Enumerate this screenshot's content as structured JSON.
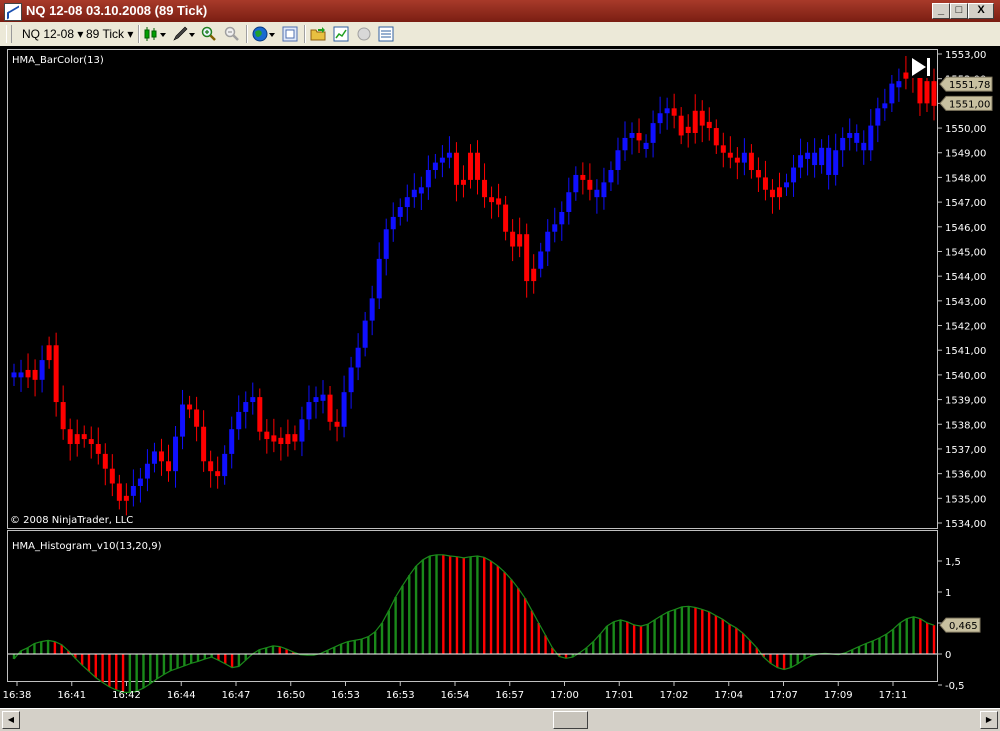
{
  "window": {
    "title": "NQ 12-08  03.10.2008 (89 Tick)",
    "minimize": "_",
    "maximize": "□",
    "close": "X"
  },
  "toolbar": {
    "instrument": "NQ 12-08",
    "interval": "89 Tick",
    "dropdown_glyph": "▾",
    "icons": [
      "candlestick-icon",
      "pencil-icon",
      "zoom-in-icon",
      "zoom-out-icon",
      "globe-icon",
      "data-box-icon",
      "folder-icon",
      "chart-properties-icon",
      "record-icon",
      "list-icon"
    ]
  },
  "price_panel": {
    "indicator_label": "HMA_BarColor(13)",
    "copyright": "© 2008 NinjaTrader, LLC",
    "y_ticks": [
      "1553,00",
      "1552,00",
      "1551,00",
      "1550,00",
      "1549,00",
      "1548,00",
      "1547,00",
      "1546,00",
      "1545,00",
      "1544,00",
      "1543,00",
      "1542,00",
      "1541,00",
      "1540,00",
      "1539,00",
      "1538,00",
      "1537,00",
      "1536,00",
      "1535,00",
      "1534,00"
    ],
    "y_tick_values": [
      1553,
      1552,
      1551,
      1550,
      1549,
      1548,
      1547,
      1546,
      1545,
      1544,
      1543,
      1542,
      1541,
      1540,
      1539,
      1538,
      1537,
      1536,
      1535,
      1534
    ],
    "price_tags": [
      {
        "text": "1551,78",
        "value": 1551.78
      },
      {
        "text": "1551,00",
        "value": 1551.0
      }
    ],
    "colors": {
      "up": "#1010ff",
      "down": "#ff0000",
      "background": "#000000"
    }
  },
  "histogram_panel": {
    "indicator_label": "HMA_Histogram_v10(13,20,9)",
    "y_ticks": [
      "1,5",
      "1",
      "0,5",
      "0",
      "-0,5"
    ],
    "y_tick_values": [
      1.5,
      1,
      0.5,
      0,
      -0.5
    ],
    "value_tag": {
      "text": "0,465",
      "value": 0.465
    },
    "colors": {
      "rising": "#1a8a1a",
      "falling": "#ff0000",
      "line": "#1a8a1a",
      "zero_line": "#ffffff"
    }
  },
  "x_axis": {
    "labels": [
      "16:38",
      "16:41",
      "16:42",
      "16:44",
      "16:47",
      "16:50",
      "16:53",
      "16:53",
      "16:54",
      "16:57",
      "17:00",
      "17:01",
      "17:02",
      "17:04",
      "17:07",
      "17:09",
      "17:11"
    ]
  },
  "chart_data": [
    {
      "type": "candlestick",
      "ylim": [
        1534,
        1553
      ],
      "close": [
        1540.1,
        1539.9,
        1540.2,
        1539.8,
        1540.6,
        1541.2,
        1538.9,
        1537.8,
        1537.2,
        1537.6,
        1537.4,
        1537.2,
        1536.8,
        1536.2,
        1535.6,
        1534.9,
        1535.1,
        1535.5,
        1535.8,
        1536.4,
        1536.9,
        1536.5,
        1536.1,
        1537.5,
        1538.8,
        1538.6,
        1537.9,
        1536.5,
        1536.1,
        1535.9,
        1536.8,
        1537.8,
        1538.5,
        1538.9,
        1539.1,
        1537.7,
        1537.4,
        1537.3,
        1537.2,
        1537.6,
        1537.3,
        1538.2,
        1538.9,
        1539.1,
        1539.2,
        1538.1,
        1537.9,
        1539.3,
        1540.3,
        1541.1,
        1542.2,
        1543.1,
        1544.7,
        1545.9,
        1546.4,
        1546.8,
        1547.2,
        1547.5,
        1547.6,
        1548.3,
        1548.6,
        1548.8,
        1549.0,
        1547.7,
        1547.9,
        1549.0,
        1547.9,
        1547.2,
        1547.0,
        1546.9,
        1545.8,
        1545.2,
        1545.7,
        1543.8,
        1544.3,
        1545.0,
        1545.8,
        1546.1,
        1546.6,
        1547.4,
        1548.1,
        1547.9,
        1547.5,
        1547.2,
        1547.8,
        1548.3,
        1549.1,
        1549.6,
        1549.8,
        1549.5,
        1549.4,
        1550.2,
        1550.6,
        1550.8,
        1550.5,
        1549.7,
        1549.8,
        1550.7,
        1550.1,
        1550.0,
        1549.3,
        1549.0,
        1548.8,
        1548.6,
        1549.0,
        1548.3,
        1548.0,
        1547.5,
        1547.2,
        1547.6,
        1547.8,
        1548.4,
        1548.9,
        1549.0,
        1548.5,
        1549.2,
        1548.1,
        1549.1,
        1549.6,
        1549.8,
        1549.4,
        1549.1,
        1550.1,
        1550.8,
        1551.0,
        1551.8,
        1551.9,
        1552.0,
        1552.1,
        1551.0,
        1551.9,
        1550.9
      ],
      "up_down": [
        1,
        1,
        0,
        0,
        1,
        0,
        0,
        0,
        0,
        0,
        0,
        0,
        0,
        0,
        0,
        0,
        0,
        1,
        1,
        1,
        1,
        0,
        0,
        1,
        1,
        0,
        0,
        0,
        0,
        0,
        1,
        1,
        1,
        1,
        1,
        0,
        0,
        0,
        0,
        0,
        0,
        1,
        1,
        1,
        1,
        0,
        0,
        1,
        1,
        1,
        1,
        1,
        1,
        1,
        1,
        1,
        1,
        1,
        1,
        1,
        1,
        1,
        1,
        0,
        0,
        0,
        0,
        0,
        0,
        0,
        0,
        0,
        0,
        0,
        0,
        1,
        1,
        1,
        1,
        1,
        1,
        0,
        0,
        1,
        1,
        1,
        1,
        1,
        1,
        0,
        1,
        1,
        1,
        1,
        0,
        0,
        0,
        0,
        0,
        0,
        0,
        0,
        0,
        0,
        1,
        0,
        0,
        0,
        0,
        0,
        1,
        1,
        1,
        1,
        1,
        1,
        1,
        1,
        1,
        1,
        1,
        1,
        1,
        1,
        1,
        1,
        1,
        0,
        0,
        0,
        0,
        0
      ]
    },
    {
      "type": "bar",
      "ylim": [
        -0.6,
        1.6
      ],
      "values": [
        -0.08,
        0.05,
        0.1,
        0.17,
        0.2,
        0.22,
        0.2,
        0.15,
        0.05,
        -0.07,
        -0.18,
        -0.28,
        -0.38,
        -0.46,
        -0.53,
        -0.58,
        -0.62,
        -0.62,
        -0.6,
        -0.55,
        -0.48,
        -0.4,
        -0.33,
        -0.27,
        -0.23,
        -0.19,
        -0.15,
        -0.12,
        -0.08,
        -0.05,
        -0.1,
        -0.16,
        -0.22,
        -0.2,
        -0.1,
        0.0,
        0.07,
        0.1,
        0.13,
        0.12,
        0.08,
        0.03,
        -0.01,
        -0.02,
        -0.02,
        0.01,
        0.06,
        0.11,
        0.16,
        0.2,
        0.22,
        0.24,
        0.28,
        0.36,
        0.5,
        0.7,
        0.92,
        1.1,
        1.27,
        1.42,
        1.52,
        1.58,
        1.6,
        1.6,
        1.58,
        1.57,
        1.55,
        1.57,
        1.58,
        1.56,
        1.5,
        1.42,
        1.32,
        1.2,
        1.06,
        0.9,
        0.7,
        0.5,
        0.3,
        0.1,
        -0.04,
        -0.07,
        -0.05,
        0.02,
        0.1,
        0.2,
        0.32,
        0.45,
        0.52,
        0.55,
        0.52,
        0.47,
        0.45,
        0.48,
        0.55,
        0.62,
        0.68,
        0.72,
        0.76,
        0.77,
        0.75,
        0.72,
        0.68,
        0.62,
        0.56,
        0.48,
        0.42,
        0.33,
        0.22,
        0.1,
        -0.05,
        -0.15,
        -0.22,
        -0.25,
        -0.22,
        -0.16,
        -0.08,
        -0.03,
        0.0,
        0.01,
        0.0,
        -0.01,
        0.02,
        0.07,
        0.12,
        0.17,
        0.21,
        0.26,
        0.32,
        0.4,
        0.5,
        0.57,
        0.6,
        0.57,
        0.5,
        0.465
      ],
      "rising": [
        1,
        1,
        1,
        1,
        1,
        1,
        0,
        0,
        0,
        0,
        0,
        0,
        0,
        0,
        0,
        0,
        0,
        1,
        1,
        1,
        1,
        1,
        1,
        1,
        1,
        1,
        1,
        1,
        1,
        1,
        0,
        0,
        0,
        1,
        1,
        1,
        1,
        1,
        1,
        0,
        0,
        0,
        0,
        1,
        1,
        1,
        1,
        1,
        1,
        1,
        1,
        1,
        1,
        1,
        1,
        1,
        1,
        1,
        1,
        1,
        1,
        1,
        1,
        0,
        0,
        0,
        0,
        1,
        1,
        0,
        0,
        0,
        0,
        0,
        0,
        0,
        0,
        0,
        0,
        0,
        0,
        0,
        1,
        1,
        1,
        1,
        1,
        1,
        1,
        1,
        0,
        0,
        0,
        1,
        1,
        1,
        1,
        1,
        1,
        1,
        0,
        0,
        0,
        0,
        0,
        0,
        0,
        0,
        0,
        0,
        0,
        0,
        0,
        0,
        1,
        1,
        1,
        1,
        1,
        1,
        0,
        0,
        1,
        1,
        1,
        1,
        1,
        1,
        1,
        1,
        1,
        1,
        1,
        0,
        0,
        0,
        0
      ]
    }
  ]
}
